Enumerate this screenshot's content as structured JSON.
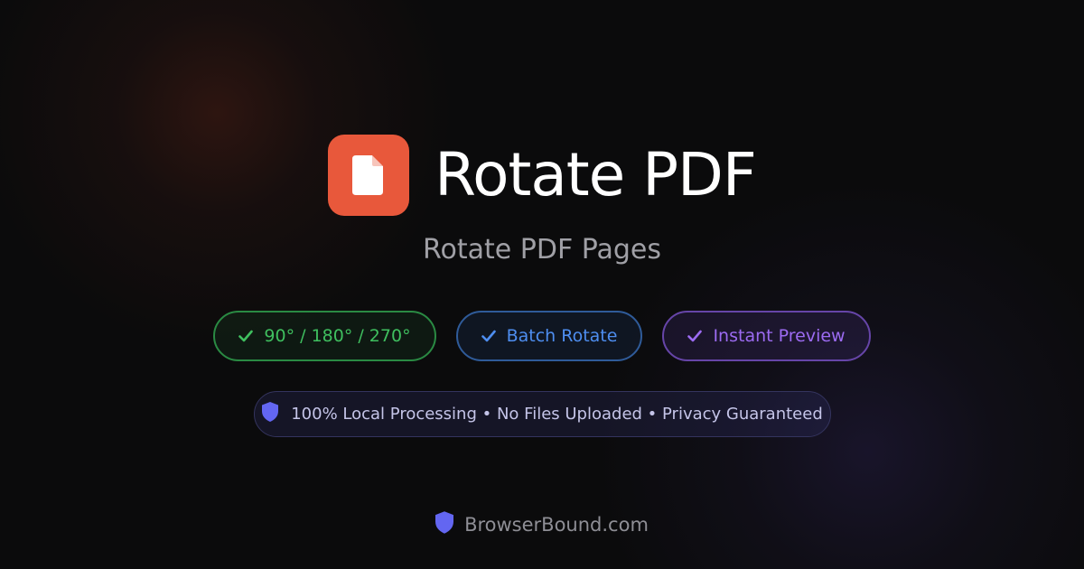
{
  "header": {
    "app_icon": "pdf-file-icon",
    "title": "Rotate PDF",
    "subtitle": "Rotate PDF Pages"
  },
  "features": [
    {
      "label": "90° / 180° / 270°",
      "icon": "check-icon",
      "color": "#3fbf5f"
    },
    {
      "label": "Batch Rotate",
      "icon": "check-icon",
      "color": "#4e8ef0"
    },
    {
      "label": "Instant Preview",
      "icon": "check-icon",
      "color": "#9c6bf2"
    }
  ],
  "privacy": {
    "icon": "shield-icon",
    "text": "100% Local Processing • No Files Uploaded • Privacy Guaranteed"
  },
  "footer": {
    "icon": "shield-icon",
    "brand": "BrowserBound.com"
  },
  "colors": {
    "accent": "#e8583b",
    "background": "#0b0b0c",
    "shield": "#6366f1"
  }
}
